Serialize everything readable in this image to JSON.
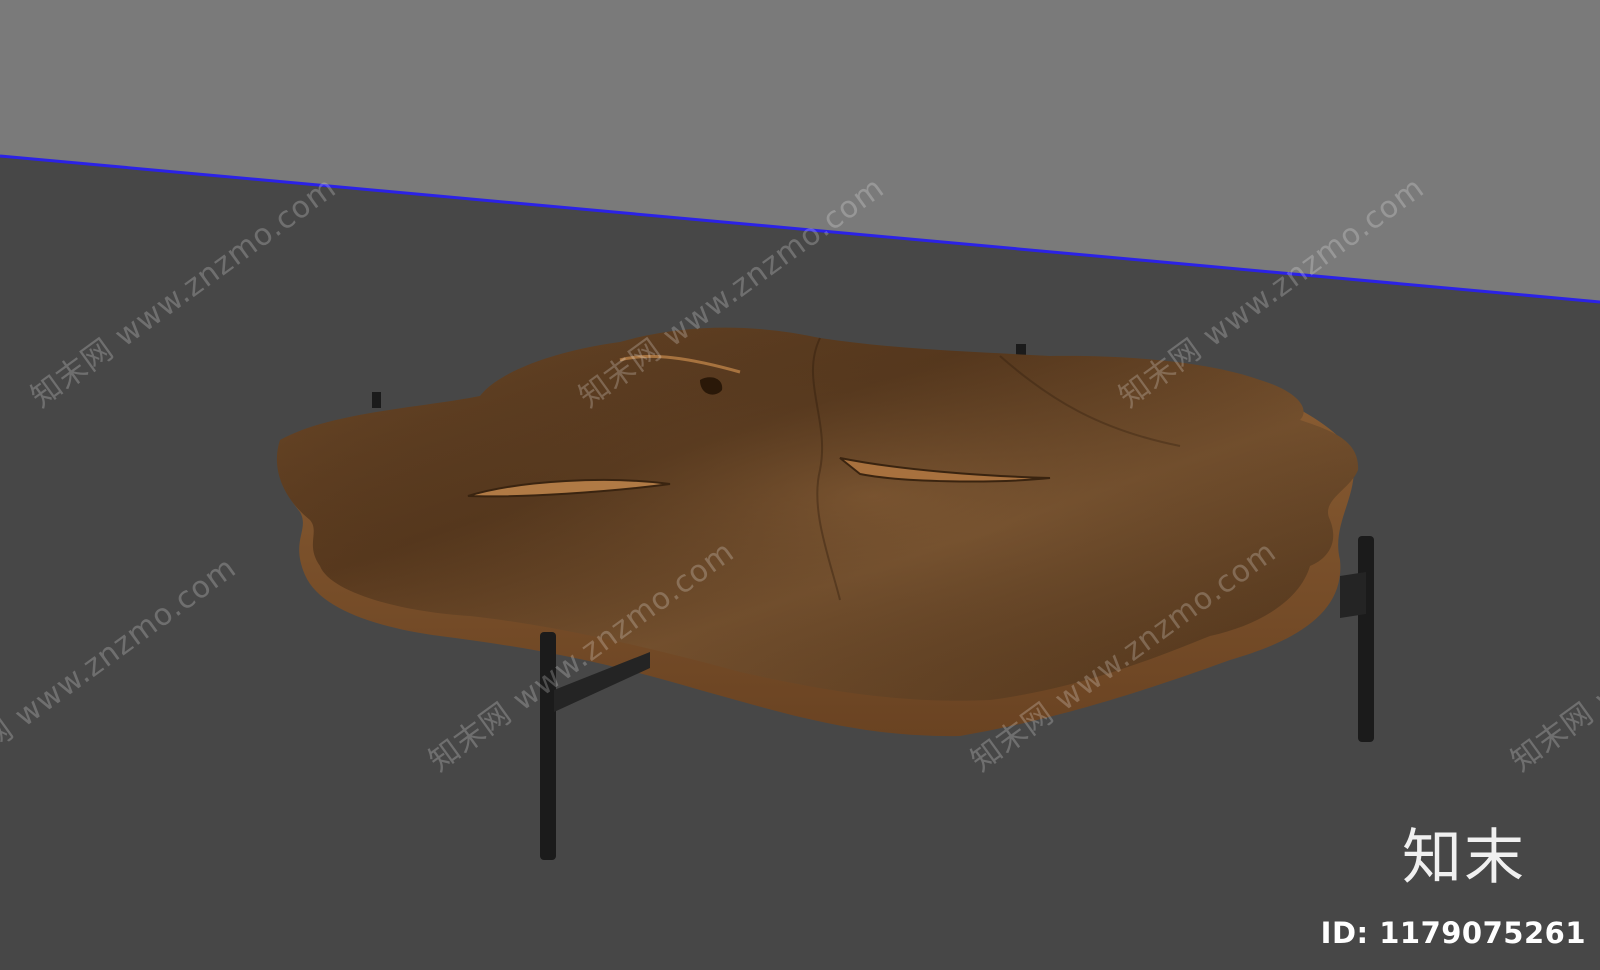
{
  "colors": {
    "background_wall": "#7a7a7a",
    "floor": "#474747",
    "horizon_line": "#2b22e6",
    "wood": "#6e4a28",
    "metal_legs": "#1b1b1b"
  },
  "watermark": {
    "site_text": "知末网 www.znzmo.com",
    "logo_text": "知末",
    "id_text": "ID: 1179075261"
  },
  "scene": {
    "object": "live-edge wood coffee table with black metal legs"
  }
}
